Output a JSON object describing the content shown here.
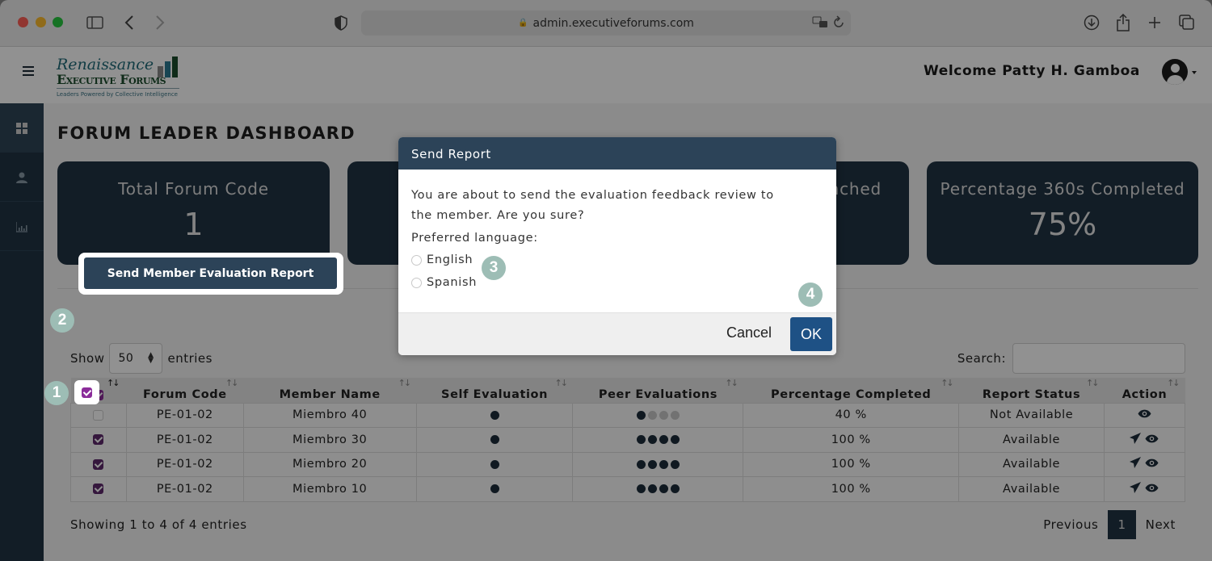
{
  "browser": {
    "url": "admin.executiveforums.com"
  },
  "header": {
    "logo_line1": "Renaissance",
    "logo_line2": "Executive Forums",
    "logo_tagline": "Leaders Powered by Collective Intelligence",
    "welcome": "Welcome Patty H. Gamboa"
  },
  "sidebar": {
    "items": [
      {
        "name": "dashboard",
        "icon": "grid-icon"
      },
      {
        "name": "members",
        "icon": "user-icon"
      },
      {
        "name": "reports",
        "icon": "chart-icon"
      }
    ]
  },
  "dashboard": {
    "title": "FORUM LEADER DASHBOARD",
    "cards": [
      {
        "label": "Total Forum Code",
        "value": "1"
      },
      {
        "label": "",
        "value": ""
      },
      {
        "label": "nched",
        "value": ""
      },
      {
        "label": "Percentage 360s Completed",
        "value": "75%"
      }
    ]
  },
  "toolbar": {
    "send_report_label": "Send Member Evaluation Report",
    "show_label": "Show",
    "entries_label": "entries",
    "page_size": "50",
    "search_label": "Search:",
    "search_value": ""
  },
  "table": {
    "columns": [
      "",
      "Forum Code",
      "Member Name",
      "Self Evaluation",
      "Peer Evaluations",
      "Percentage Completed",
      "Report Status",
      "Action"
    ],
    "header_checked": true,
    "rows": [
      {
        "checked": false,
        "forum_code": "PE-01-02",
        "member": "Miembro 40",
        "self_eval_done": 1,
        "peer_done": 1,
        "peer_total": 4,
        "percentage": "40 %",
        "status": "Not Available",
        "actions": [
          "view"
        ]
      },
      {
        "checked": true,
        "forum_code": "PE-01-02",
        "member": "Miembro 30",
        "self_eval_done": 1,
        "peer_done": 4,
        "peer_total": 4,
        "percentage": "100 %",
        "status": "Available",
        "actions": [
          "send",
          "view"
        ]
      },
      {
        "checked": true,
        "forum_code": "PE-01-02",
        "member": "Miembro 20",
        "self_eval_done": 1,
        "peer_done": 4,
        "peer_total": 4,
        "percentage": "100 %",
        "status": "Available",
        "actions": [
          "send",
          "view"
        ]
      },
      {
        "checked": true,
        "forum_code": "PE-01-02",
        "member": "Miembro 10",
        "self_eval_done": 1,
        "peer_done": 4,
        "peer_total": 4,
        "percentage": "100 %",
        "status": "Available",
        "actions": [
          "send",
          "view"
        ]
      }
    ]
  },
  "footer": {
    "showing": "Showing 1 to 4 of 4 entries",
    "previous": "Previous",
    "current_page": "1",
    "next": "Next"
  },
  "modal": {
    "title": "Send Report",
    "message": "You are about to send the evaluation feedback review to the member. Are you sure?",
    "language_label": "Preferred language:",
    "options": [
      "English",
      "Spanish"
    ],
    "cancel": "Cancel",
    "ok": "OK"
  },
  "annotations": [
    "1",
    "2",
    "3",
    "4"
  ],
  "colors": {
    "primary": "#2c4358",
    "card_bg": "#203444",
    "ok_button": "#1e5185",
    "checkbox": "#8b2c9a",
    "badge": "#9dbdb5"
  }
}
